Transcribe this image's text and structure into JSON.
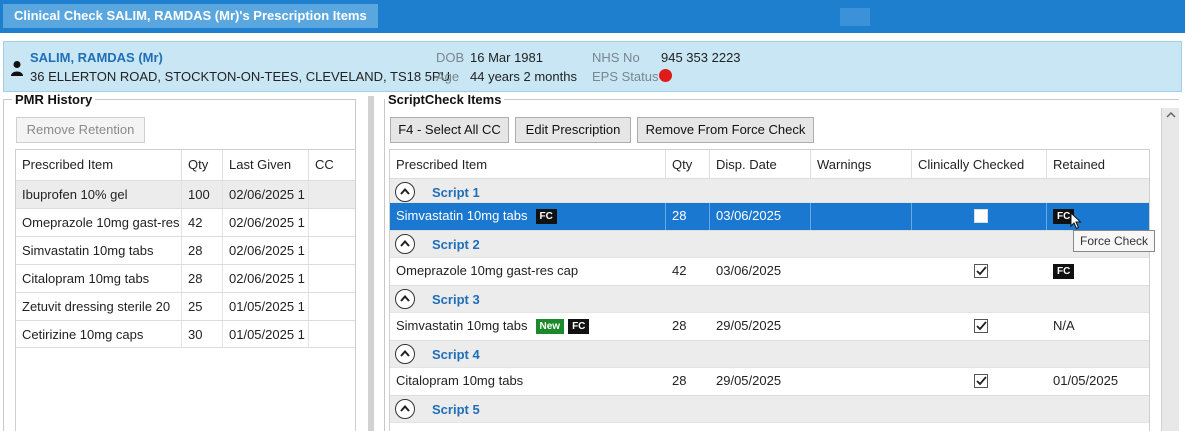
{
  "window": {
    "title": "Clinical Check SALIM, RAMDAS (Mr)'s Prescription Items"
  },
  "patient": {
    "name": "SALIM, RAMDAS (Mr)",
    "address": "36 ELLERTON ROAD, STOCKTON-ON-TEES, CLEVELAND, TS18 5PU",
    "dob_label": "DOB",
    "dob": "16 Mar 1981",
    "age_label": "Age",
    "age": "44 years 2 months",
    "nhs_label": "NHS No",
    "nhs_no": "945 353 2223",
    "eps_label": "EPS Status",
    "eps_color": "#e01b1b"
  },
  "pmr": {
    "title": "PMR History",
    "remove_retention": "Remove Retention",
    "columns": [
      "Prescribed Item",
      "Qty",
      "Last Given",
      "CC"
    ],
    "rows": [
      {
        "item": "Ibuprofen 10% gel",
        "qty": "100",
        "last": "02/06/2025 1",
        "cc": ""
      },
      {
        "item": "Omeprazole 10mg gast-res",
        "qty": "42",
        "last": "02/06/2025 1",
        "cc": ""
      },
      {
        "item": "Simvastatin 10mg tabs",
        "qty": "28",
        "last": "02/06/2025 1",
        "cc": ""
      },
      {
        "item": "Citalopram 10mg tabs",
        "qty": "28",
        "last": "02/06/2025 1",
        "cc": ""
      },
      {
        "item": "Zetuvit dressing sterile 20",
        "qty": "25",
        "last": "01/05/2025 1",
        "cc": ""
      },
      {
        "item": "Cetirizine 10mg caps",
        "qty": "30",
        "last": "01/05/2025 1",
        "cc": ""
      }
    ]
  },
  "scriptcheck": {
    "title": "ScriptCheck Items",
    "btn_select_all": "F4 - Select All CC",
    "btn_edit": "Edit Prescription",
    "btn_remove_fc": "Remove From Force Check",
    "columns": [
      "Prescribed Item",
      "Qty",
      "Disp. Date",
      "Warnings",
      "Clinically Checked",
      "Retained"
    ],
    "scripts": [
      {
        "label": "Script 1",
        "item": "Simvastatin 10mg tabs",
        "qty": "28",
        "date": "03/06/2025",
        "warnings": "",
        "checked": false,
        "retained": "",
        "retained_badge": "FC",
        "item_badges": [
          "FC"
        ],
        "selected": true
      },
      {
        "label": "Script 2",
        "item": "Omeprazole 10mg gast-res cap",
        "qty": "42",
        "date": "03/06/2025",
        "warnings": "",
        "checked": true,
        "retained": "",
        "retained_badge": "FC",
        "item_badges": [],
        "selected": false
      },
      {
        "label": "Script 3",
        "item": "Simvastatin 10mg tabs",
        "qty": "28",
        "date": "29/05/2025",
        "warnings": "",
        "checked": true,
        "retained": "N/A",
        "retained_badge": "",
        "item_badges": [
          "New",
          "FC"
        ],
        "selected": false
      },
      {
        "label": "Script 4",
        "item": "Citalopram 10mg tabs",
        "qty": "28",
        "date": "29/05/2025",
        "warnings": "",
        "checked": true,
        "retained": "01/05/2025",
        "retained_badge": "",
        "item_badges": [],
        "selected": false
      },
      {
        "label": "Script 5",
        "item": "",
        "qty": "",
        "date": "",
        "warnings": "",
        "checked": false,
        "retained": "",
        "retained_badge": "",
        "item_badges": [],
        "selected": false
      }
    ],
    "tooltip": "Force Check"
  }
}
